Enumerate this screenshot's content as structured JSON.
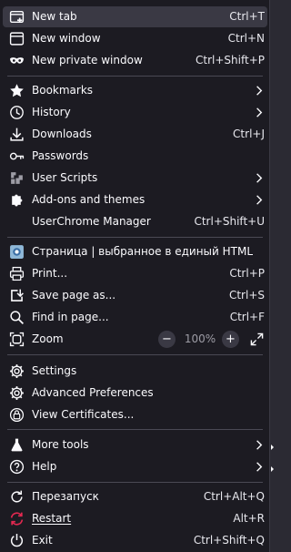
{
  "colors": {
    "menu_bg": "#1c1b22",
    "hover_bg": "#3a3944",
    "text": "#fbfbfe",
    "muted": "#9d9ca5",
    "separator": "#4a4954",
    "accent_red": "#e22850"
  },
  "items": {
    "new_tab": {
      "label": "New tab",
      "shortcut": "Ctrl+T",
      "icon": "new-tab-icon"
    },
    "new_window": {
      "label": "New window",
      "shortcut": "Ctrl+N",
      "icon": "window-icon"
    },
    "new_private_window": {
      "label": "New private window",
      "shortcut": "Ctrl+Shift+P",
      "icon": "private-mask-icon"
    },
    "bookmarks": {
      "label": "Bookmarks",
      "icon": "star-icon"
    },
    "history": {
      "label": "History",
      "icon": "clock-icon"
    },
    "downloads": {
      "label": "Downloads",
      "shortcut": "Ctrl+J",
      "icon": "download-icon"
    },
    "passwords": {
      "label": "Passwords",
      "icon": "key-icon"
    },
    "user_scripts": {
      "label": "User Scripts",
      "icon": "puzzle-icon"
    },
    "addons": {
      "label": "Add-ons and themes",
      "icon": "puzzle-icon"
    },
    "userchrome": {
      "label": "UserChrome Manager",
      "shortcut": "Ctrl+Shift+U"
    },
    "save_page_html": {
      "label": "Страница | выбранное в единый HTML",
      "icon": "page-html-icon"
    },
    "print": {
      "label": "Print...",
      "shortcut": "Ctrl+P",
      "icon": "printer-icon"
    },
    "save_page_as": {
      "label": "Save page as...",
      "shortcut": "Ctrl+S",
      "icon": "save-icon"
    },
    "find_in_page": {
      "label": "Find in page...",
      "shortcut": "Ctrl+F",
      "icon": "search-icon"
    },
    "zoom": {
      "label": "Zoom",
      "value": "100%",
      "minus": "−",
      "plus": "+",
      "icon": "zoom-icon"
    },
    "settings": {
      "label": "Settings",
      "icon": "gear-icon"
    },
    "advanced_prefs": {
      "label": "Advanced Preferences",
      "icon": "gear-icon"
    },
    "view_certs": {
      "label": "View Certificates...",
      "icon": "certificate-icon"
    },
    "more_tools": {
      "label": "More tools",
      "icon": "flask-icon"
    },
    "help": {
      "label": "Help",
      "icon": "help-icon"
    },
    "restart_ru": {
      "label": "Перезапуск",
      "shortcut": "Ctrl+Alt+Q",
      "icon": "restart-icon"
    },
    "restart": {
      "label": "Restart",
      "shortcut": "Alt+R",
      "icon": "restart-red-icon"
    },
    "exit": {
      "label": "Exit",
      "shortcut": "Ctrl+Shift+Q",
      "icon": "power-icon"
    }
  }
}
